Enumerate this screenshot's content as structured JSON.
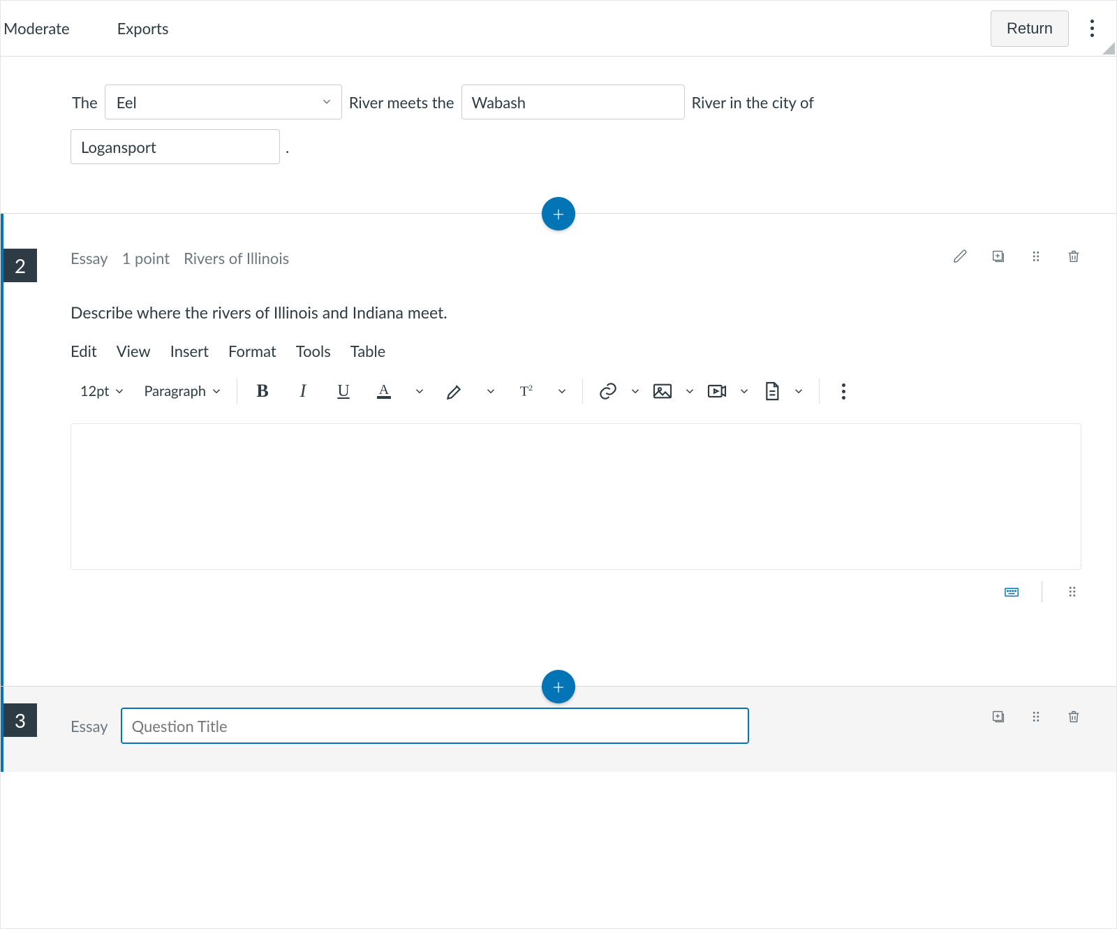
{
  "topbar": {
    "nav": [
      "Moderate",
      "Exports"
    ],
    "return_label": "Return"
  },
  "question1": {
    "sentence_parts": {
      "p0": "The",
      "p1": "River meets the",
      "p2": "River in the city of",
      "p3": "."
    },
    "blank1_value": "Eel",
    "blank2_value": "Wabash",
    "blank3_value": "Logansport"
  },
  "question2": {
    "number": "2",
    "type": "Essay",
    "points": "1 point",
    "bank": "Rivers of Illinois",
    "prompt": "Describe where the rivers of Illinois and Indiana meet.",
    "rce": {
      "menus": [
        "Edit",
        "View",
        "Insert",
        "Format",
        "Tools",
        "Table"
      ],
      "font_size": "12pt",
      "block": "Paragraph"
    }
  },
  "question3": {
    "number": "3",
    "type": "Essay",
    "title_placeholder": "Question Title"
  }
}
